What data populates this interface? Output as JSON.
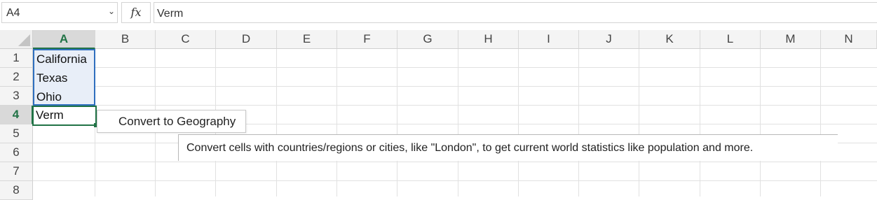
{
  "formula_bar": {
    "name_box": "A4",
    "fx_label": "fx",
    "formula_value": "Verm"
  },
  "columns": [
    "A",
    "B",
    "C",
    "D",
    "E",
    "F",
    "G",
    "H",
    "I",
    "J",
    "K",
    "L",
    "M",
    "N"
  ],
  "rows": [
    "1",
    "2",
    "3",
    "4",
    "5",
    "6",
    "7",
    "8"
  ],
  "cells": {
    "A1": "California",
    "A2": "Texas",
    "A3": "Ohio",
    "A4": "Verm"
  },
  "selection": {
    "active_cell": "A4",
    "active_column": "A",
    "active_row": "4"
  },
  "autocomplete_popup": {
    "label": "Convert to Geography"
  },
  "tooltip": {
    "text": "Convert cells with countries/regions or cities, like \"London\", to get current world statistics like population and more."
  },
  "colors": {
    "accent_green": "#217346",
    "selection_blue": "#2f6fbf",
    "selection_fill": "#e8eef8"
  }
}
